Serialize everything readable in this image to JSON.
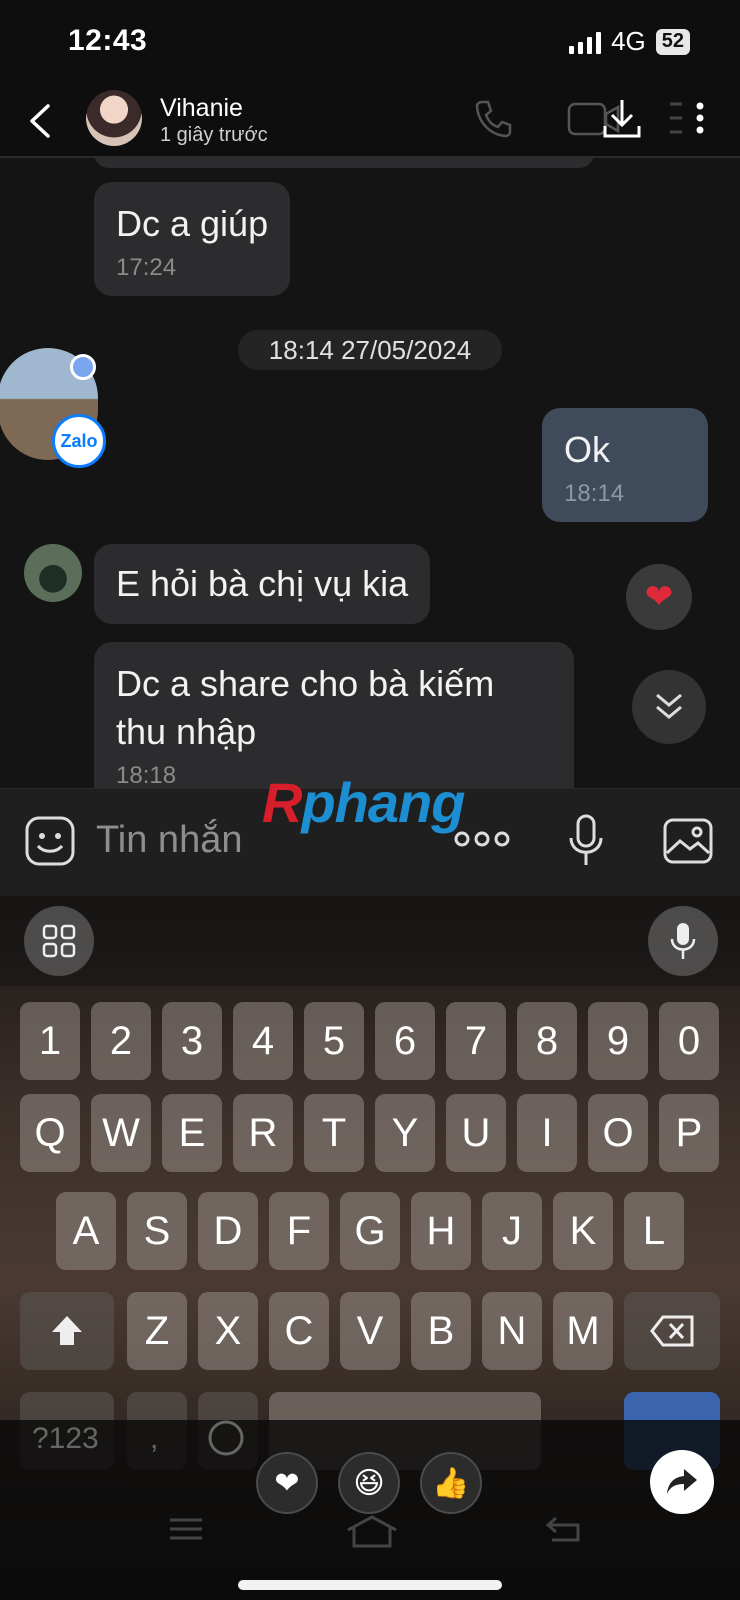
{
  "status_bar": {
    "time": "12:43",
    "network": "4G",
    "battery": "52"
  },
  "header": {
    "contact_name": "Vihanie",
    "contact_status": "1 giây trước",
    "icons": [
      "back-arrow-icon",
      "phone-icon",
      "video-icon",
      "download-icon",
      "more-icon"
    ]
  },
  "messages": [
    {
      "sender": "contact",
      "text": "Dc a giúp",
      "time": "17:24"
    },
    {
      "sender": "me",
      "text": "Ok",
      "time": "18:14"
    },
    {
      "sender": "contact",
      "text": "E hỏi bà chị vụ kia"
    },
    {
      "sender": "contact",
      "text": "Dc a share cho bà kiếm thu nhập",
      "time": "18:18"
    }
  ],
  "date_separator": "18:14 27/05/2024",
  "zalo_badge": "Zalo",
  "reaction_heart": "❤",
  "watermark": {
    "r": "R",
    "rest": "phang"
  },
  "input": {
    "placeholder": "Tin nhắn"
  },
  "keyboard": {
    "row_numbers": [
      "1",
      "2",
      "3",
      "4",
      "5",
      "6",
      "7",
      "8",
      "9",
      "0"
    ],
    "row_1": [
      "Q",
      "W",
      "E",
      "R",
      "T",
      "Y",
      "U",
      "I",
      "O",
      "P"
    ],
    "row_2": [
      "A",
      "S",
      "D",
      "F",
      "G",
      "H",
      "J",
      "K",
      "L"
    ],
    "row_3": [
      "Z",
      "X",
      "C",
      "V",
      "B",
      "N",
      "M"
    ],
    "bottom_left": "?123",
    "comma": ","
  },
  "quick_reactions": [
    "❤",
    "😆",
    "👍"
  ],
  "colors": {
    "my_bubble": "#3f4a5a",
    "their_bubble": "#2c2c2e",
    "accent": "#0a7cff"
  }
}
